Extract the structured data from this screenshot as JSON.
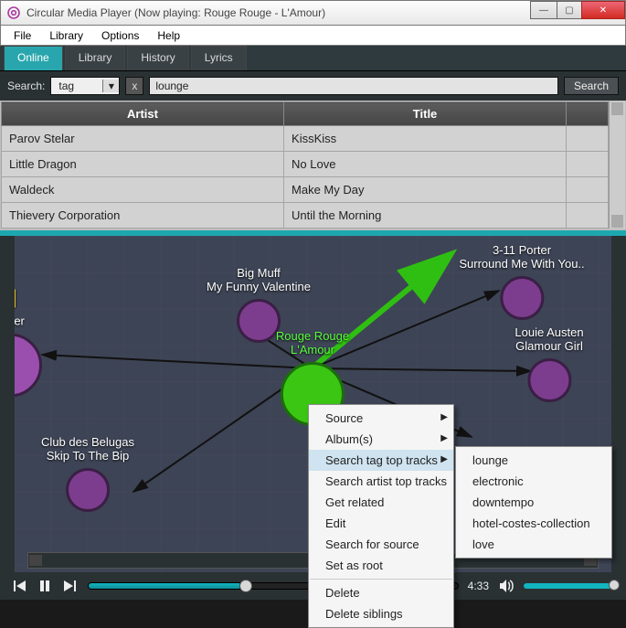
{
  "window": {
    "title": "Circular Media Player (Now playing: Rouge Rouge - L'Amour)"
  },
  "menubar": {
    "file": "File",
    "library": "Library",
    "options": "Options",
    "help": "Help"
  },
  "tabs": {
    "online": "Online",
    "library": "Library",
    "history": "History",
    "lyrics": "Lyrics"
  },
  "search": {
    "label": "Search:",
    "type": "tag",
    "query": "lounge",
    "button": "Search"
  },
  "table": {
    "cols": {
      "artist": "Artist",
      "title": "Title"
    },
    "rows": [
      {
        "artist": "Parov Stelar",
        "title": "KissKiss"
      },
      {
        "artist": "Little Dragon",
        "title": "No Love"
      },
      {
        "artist": "Waldeck",
        "title": "Make My Day"
      },
      {
        "artist": "Thievery Corporation",
        "title": "Until the Morning"
      }
    ]
  },
  "graph": {
    "nodes": {
      "partialLeft": {
        "line1": "d",
        "line2": ":loser"
      },
      "bigmuff": {
        "line1": "Big Muff",
        "line2": "My Funny Valentine"
      },
      "porter": {
        "line1": "3-11 Porter",
        "line2": "Surround Me With You.."
      },
      "current": {
        "line1": "Rouge Rouge",
        "line2": "L'Amour"
      },
      "austen": {
        "line1": "Louie Austen",
        "line2": "Glamour Girl"
      },
      "belugas": {
        "line1": "Club des Belugas",
        "line2": "Skip To The Bip"
      }
    }
  },
  "ctx": {
    "items": {
      "source": "Source",
      "albums": "Album(s)",
      "searchTag": "Search tag top tracks",
      "searchArtist": "Search artist top tracks",
      "getRelated": "Get related",
      "edit": "Edit",
      "searchSource": "Search for source",
      "setRoot": "Set as root",
      "delete": "Delete",
      "deleteSiblings": "Delete siblings"
    }
  },
  "submenu": {
    "items": [
      "lounge",
      "electronic",
      "downtempo",
      "hotel-costes-collection",
      "love"
    ]
  },
  "player": {
    "time": "4:33"
  }
}
